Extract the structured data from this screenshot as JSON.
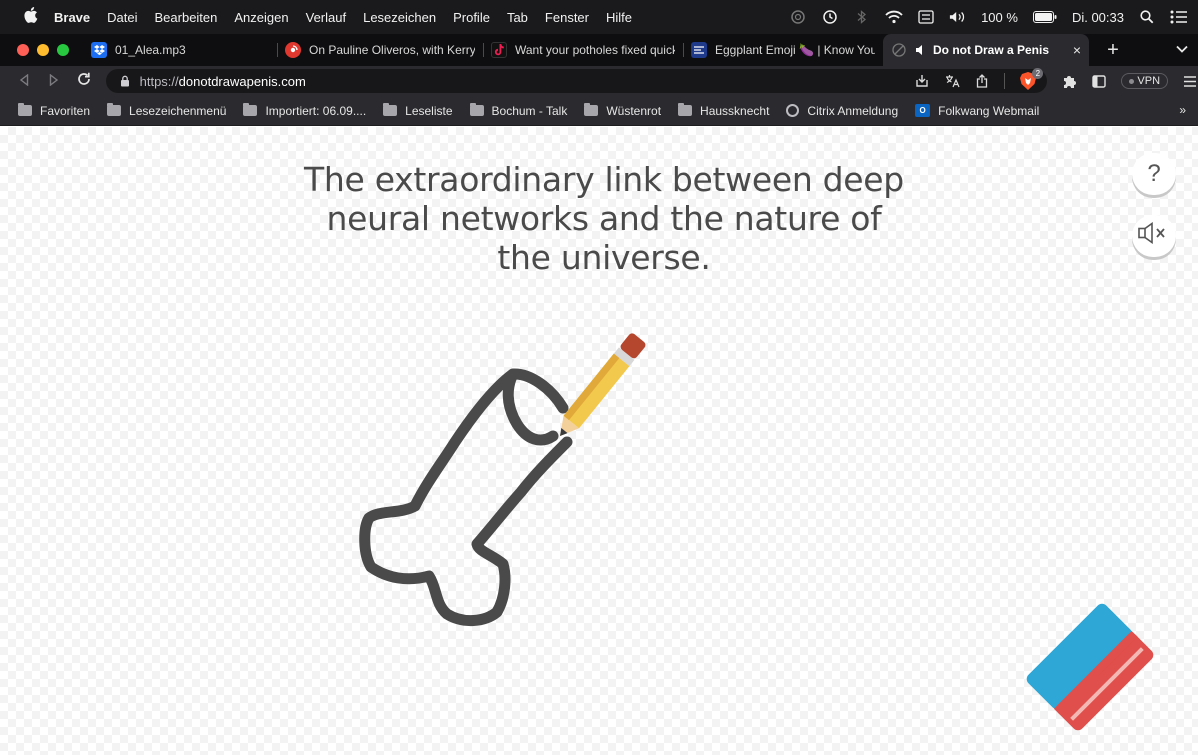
{
  "menubar": {
    "app_name": "Brave",
    "items": [
      "Datei",
      "Bearbeiten",
      "Anzeigen",
      "Verlauf",
      "Lesezeichen",
      "Profile",
      "Tab",
      "Fenster",
      "Hilfe"
    ],
    "battery": "100 %",
    "clock": "Di. 00:33",
    "icons": [
      "apple-icon",
      "brave-rewards-icon",
      "time-machine-icon",
      "bluetooth-icon",
      "wifi-icon",
      "keyboard-layout-icon",
      "volume-icon",
      "battery-icon",
      "spotlight-icon",
      "control-center-icon"
    ]
  },
  "tabs": [
    {
      "label": "01_Alea.mp3",
      "favicon": "dropbox-icon",
      "color": "#1e6ef2"
    },
    {
      "label": "On Pauline Oliveros, with Kerry (",
      "favicon": "podcast-icon",
      "color": "#e0382f"
    },
    {
      "label": "Want your potholes fixed quickl",
      "favicon": "tiktok-icon",
      "color": "#111111"
    },
    {
      "label": "Eggplant Emoji 🍆 | Know Your I",
      "favicon": "kym-icon",
      "color": "#1f3a8a"
    },
    {
      "label": "Do not Draw a Penis",
      "favicon": "site-icon",
      "color": "#555555",
      "active": true,
      "audio": "speaker-icon",
      "close": "×"
    }
  ],
  "new_tab": "+",
  "tab_menu": "⌄",
  "toolbar": {
    "url_prefix": "https://",
    "url_host": "donotdrawapenis.com",
    "vpn_label": "VPN",
    "shield_count": "2"
  },
  "bookmarks": [
    {
      "label": "Favoriten",
      "icon": "folder-icon"
    },
    {
      "label": "Lesezeichenmenü",
      "icon": "folder-icon"
    },
    {
      "label": "Importiert: 06.09....",
      "icon": "folder-icon"
    },
    {
      "label": "Leseliste",
      "icon": "folder-icon"
    },
    {
      "label": "Bochum - Talk",
      "icon": "folder-icon"
    },
    {
      "label": "Wüstenrot",
      "icon": "folder-icon"
    },
    {
      "label": "Haussknecht",
      "icon": "folder-icon"
    },
    {
      "label": "Citrix Anmeldung",
      "icon": "citrix-icon"
    },
    {
      "label": "Folkwang Webmail",
      "icon": "outlook-icon"
    }
  ],
  "bookmarks_more": "»",
  "page": {
    "headline": "The extraordinary link between deep neural networks and the nature of the universe.",
    "help_label": "?",
    "colors": {
      "stroke": "#4a4a4a",
      "pencil_body": "#f2c94c",
      "pencil_eraser": "#b5472f",
      "eraser_top": "#2ea6d6",
      "eraser_bottom": "#e04f4b"
    }
  }
}
